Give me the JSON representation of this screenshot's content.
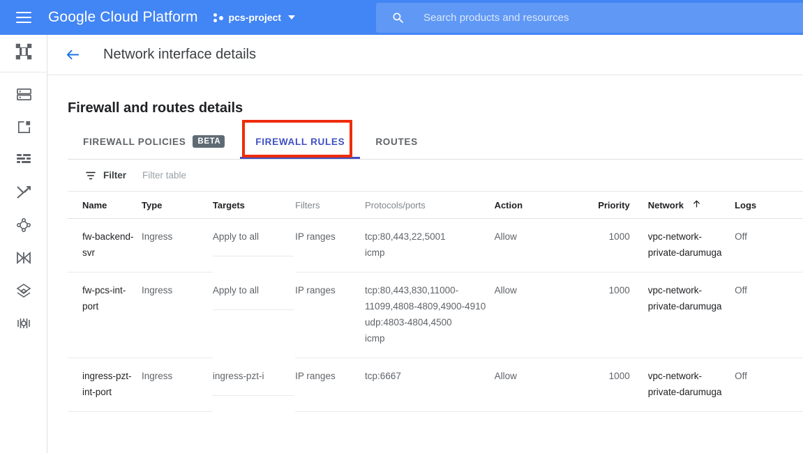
{
  "topbar": {
    "menu_icon": "hamburger-menu-icon",
    "brand": "Google Cloud Platform",
    "project_name": "pcs-project",
    "project_icon": "project-dots-icon",
    "caret_icon": "chevron-down-icon",
    "search": {
      "icon": "search-icon",
      "placeholder": "Search products and resources",
      "value": ""
    }
  },
  "rail": {
    "items": [
      {
        "name": "vpc-network-icon",
        "label": "VPC network"
      },
      {
        "name": "ip-addresses-icon",
        "label": "IP addresses"
      },
      {
        "name": "subnets-icon",
        "label": "Subnets"
      },
      {
        "name": "firewall-icon",
        "label": "Firewall"
      },
      {
        "name": "routes-icon",
        "label": "Routes"
      },
      {
        "name": "vpc-peering-icon",
        "label": "VPC network peering"
      },
      {
        "name": "shared-vpc-icon",
        "label": "Shared VPC"
      },
      {
        "name": "serverless-vpc-access-icon",
        "label": "Serverless VPC access"
      },
      {
        "name": "packet-mirroring-icon",
        "label": "Packet mirroring"
      }
    ]
  },
  "page": {
    "back_icon": "back-arrow-icon",
    "title": "Network interface details",
    "section_title": "Firewall and routes details"
  },
  "tabs": [
    {
      "label": "FIREWALL POLICIES",
      "badge": "BETA",
      "active": false
    },
    {
      "label": "FIREWALL RULES",
      "badge": "",
      "active": true
    },
    {
      "label": "ROUTES",
      "badge": "",
      "active": false
    }
  ],
  "highlight": {
    "color": "#ef2c0b",
    "target": "FIREWALL RULES"
  },
  "filter": {
    "icon": "filter-icon",
    "label": "Filter",
    "placeholder": "Filter table",
    "value": ""
  },
  "table": {
    "columns": [
      {
        "label": "Name",
        "emphasis": "dark",
        "sort": ""
      },
      {
        "label": "Type",
        "emphasis": "dark",
        "sort": ""
      },
      {
        "label": "Targets",
        "emphasis": "dark",
        "sort": ""
      },
      {
        "label": "Filters",
        "emphasis": "light",
        "sort": ""
      },
      {
        "label": "Protocols/ports",
        "emphasis": "light",
        "sort": ""
      },
      {
        "label": "Action",
        "emphasis": "dark",
        "sort": ""
      },
      {
        "label": "Priority",
        "emphasis": "dark",
        "sort": ""
      },
      {
        "label": "Network",
        "emphasis": "dark",
        "sort": "ascending"
      },
      {
        "label": "Logs",
        "emphasis": "dark",
        "sort": ""
      }
    ],
    "sort_icon": "arrow-up-icon",
    "rows": [
      {
        "name": "fw-backend-svr",
        "type": "Ingress",
        "targets": "Apply to all",
        "filters": "IP ranges",
        "protocols": [
          "tcp:80,443,22,5001",
          "icmp"
        ],
        "action": "Allow",
        "priority": "1000",
        "network": "vpc-network-private-darumuga",
        "logs": "Off"
      },
      {
        "name": "fw-pcs-int-port",
        "type": "Ingress",
        "targets": "Apply to all",
        "filters": "IP ranges",
        "protocols": [
          "tcp:80,443,830,11000-11099,4808-4809,4900-4910",
          "udp:4803-4804,4500",
          "icmp"
        ],
        "action": "Allow",
        "priority": "1000",
        "network": "vpc-network-private-darumuga",
        "logs": "Off"
      },
      {
        "name": "ingress-pzt-int-port",
        "type": "Ingress",
        "targets": "ingress-pzt-i",
        "filters": "IP ranges",
        "protocols": [
          "tcp:6667"
        ],
        "action": "Allow",
        "priority": "1000",
        "network": "vpc-network-private-darumuga",
        "logs": "Off"
      }
    ]
  }
}
